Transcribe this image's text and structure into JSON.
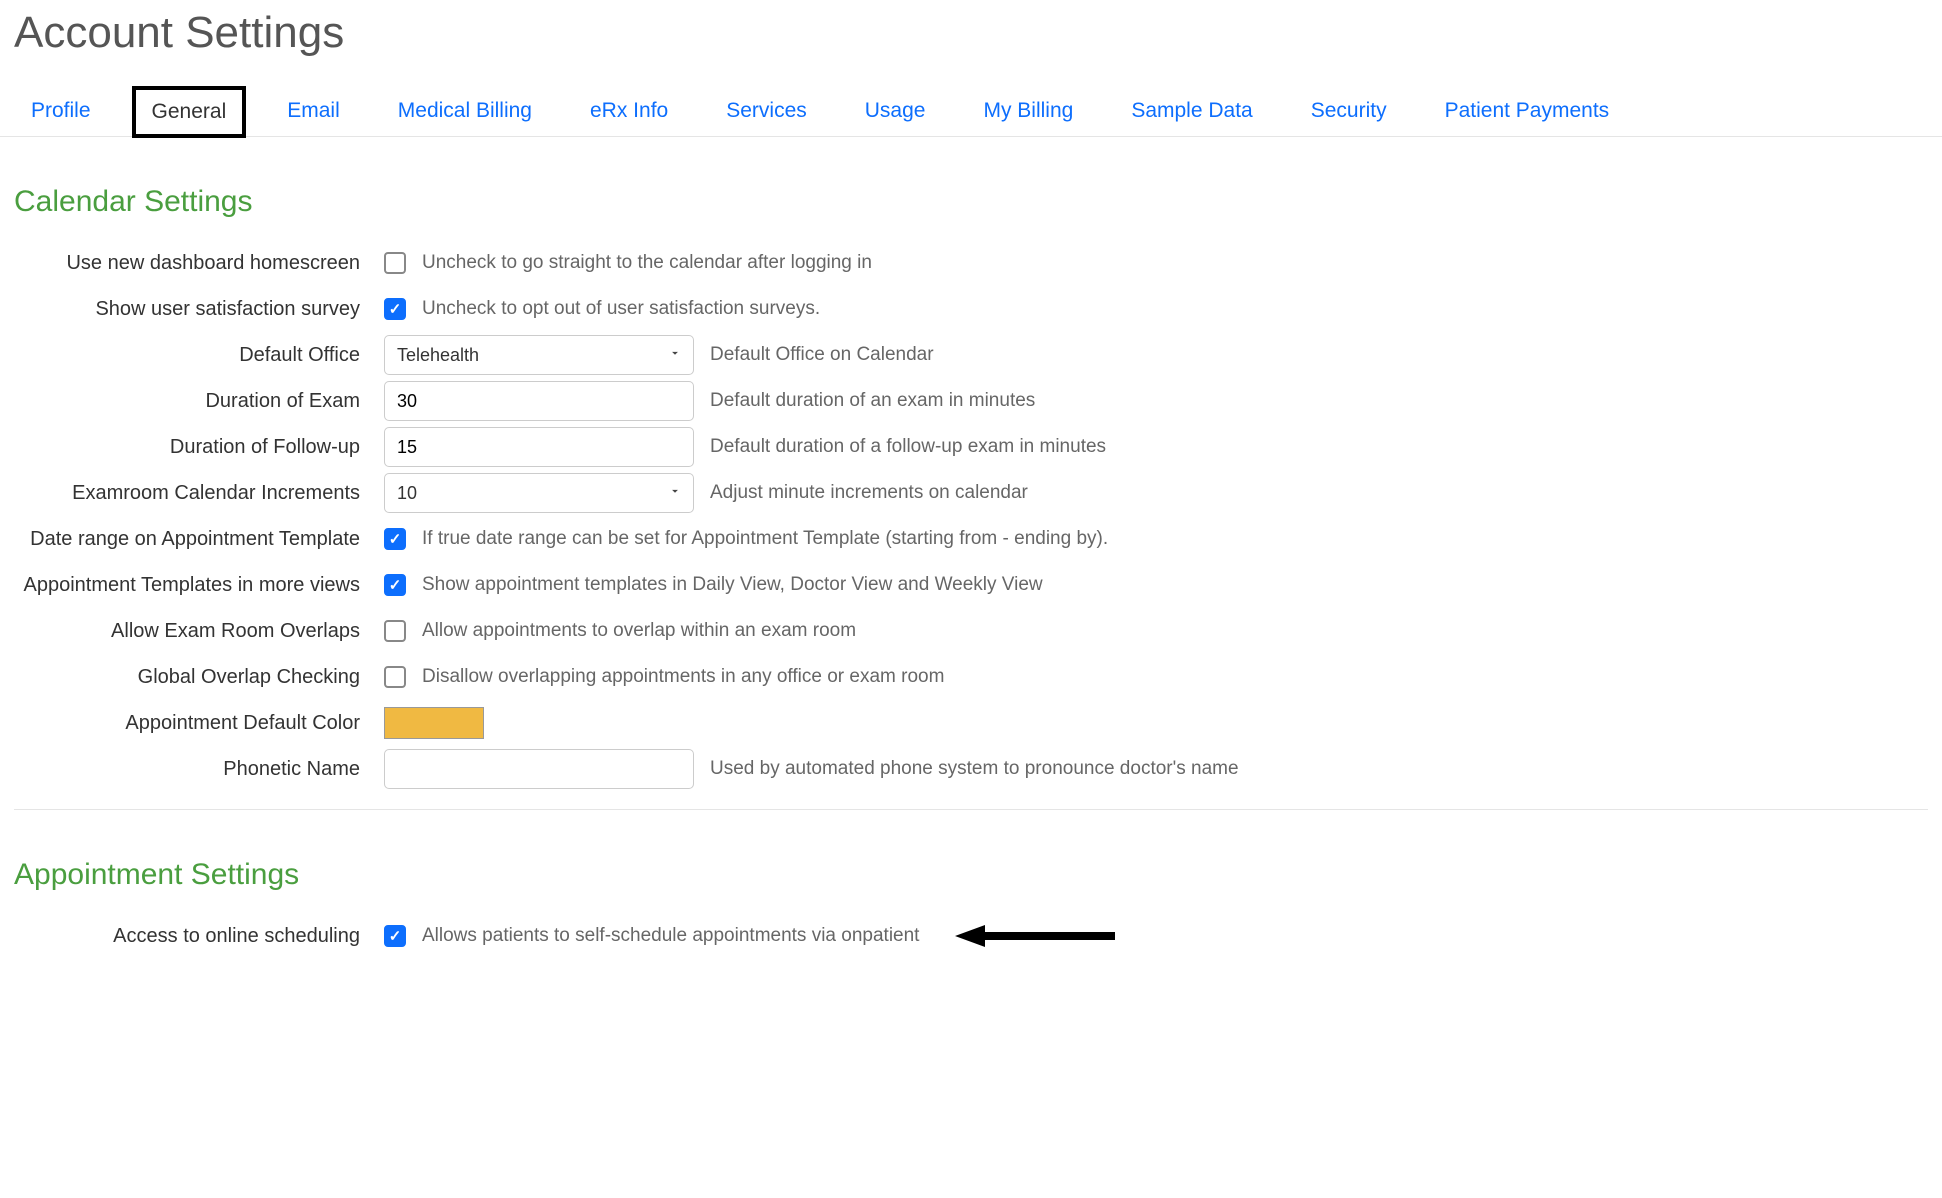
{
  "page_title": "Account Settings",
  "tabs": [
    {
      "id": "profile",
      "label": "Profile",
      "active": false
    },
    {
      "id": "general",
      "label": "General",
      "active": true
    },
    {
      "id": "email",
      "label": "Email",
      "active": false
    },
    {
      "id": "medical-billing",
      "label": "Medical Billing",
      "active": false
    },
    {
      "id": "erx-info",
      "label": "eRx Info",
      "active": false
    },
    {
      "id": "services",
      "label": "Services",
      "active": false
    },
    {
      "id": "usage",
      "label": "Usage",
      "active": false
    },
    {
      "id": "my-billing",
      "label": "My Billing",
      "active": false
    },
    {
      "id": "sample-data",
      "label": "Sample Data",
      "active": false
    },
    {
      "id": "security",
      "label": "Security",
      "active": false
    },
    {
      "id": "patient-payments",
      "label": "Patient Payments",
      "active": false
    }
  ],
  "sections": {
    "calendar": {
      "title": "Calendar Settings",
      "rows": {
        "use_new_dashboard": {
          "label": "Use new dashboard homescreen",
          "checked": false,
          "hint": "Uncheck to go straight to the calendar after logging in"
        },
        "satisfaction_survey": {
          "label": "Show user satisfaction survey",
          "checked": true,
          "hint": "Uncheck to opt out of user satisfaction surveys."
        },
        "default_office": {
          "label": "Default Office",
          "value": "Telehealth",
          "hint": "Default Office on Calendar"
        },
        "duration_exam": {
          "label": "Duration of Exam",
          "value": "30",
          "hint": "Default duration of an exam in minutes"
        },
        "duration_followup": {
          "label": "Duration of Follow-up",
          "value": "15",
          "hint": "Default duration of a follow-up exam in minutes"
        },
        "examroom_increments": {
          "label": "Examroom Calendar Increments",
          "value": "10",
          "hint": "Adjust minute increments on calendar"
        },
        "date_range_template": {
          "label": "Date range on Appointment Template",
          "checked": true,
          "hint": "If true date range can be set for Appointment Template (starting from - ending by)."
        },
        "templates_more_views": {
          "label": "Appointment Templates in more views",
          "checked": true,
          "hint": "Show appointment templates in Daily View, Doctor View and Weekly View"
        },
        "allow_overlaps": {
          "label": "Allow Exam Room Overlaps",
          "checked": false,
          "hint": "Allow appointments to overlap within an exam room"
        },
        "global_overlap": {
          "label": "Global Overlap Checking",
          "checked": false,
          "hint": "Disallow overlapping appointments in any office or exam room"
        },
        "default_color": {
          "label": "Appointment Default Color",
          "value": "#f0b942"
        },
        "phonetic_name": {
          "label": "Phonetic Name",
          "value": "",
          "hint": "Used by automated phone system to pronounce doctor's name"
        }
      }
    },
    "appointment": {
      "title": "Appointment Settings",
      "rows": {
        "online_scheduling": {
          "label": "Access to online scheduling",
          "checked": true,
          "hint": "Allows patients to self-schedule appointments via onpatient"
        }
      }
    }
  }
}
